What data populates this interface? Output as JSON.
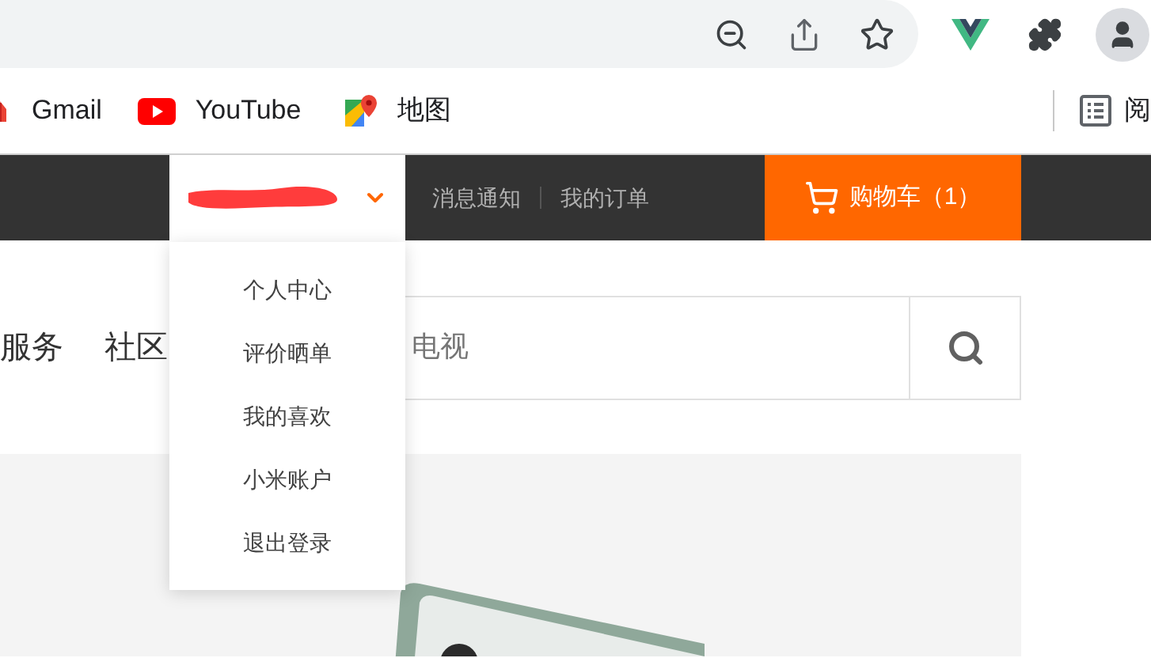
{
  "bookmarks": [
    {
      "kind": "gmail",
      "label": "Gmail"
    },
    {
      "kind": "youtube",
      "label": "YouTube"
    },
    {
      "kind": "maps",
      "label": "地图"
    }
  ],
  "reading_list": {
    "label": "阅"
  },
  "top_bar": {
    "user_menu": {
      "expanded": true,
      "items": [
        "个人中心",
        "评价晒单",
        "我的喜欢",
        "小米账户",
        "退出登录"
      ]
    },
    "links": [
      "消息通知",
      "我的订单"
    ],
    "cart": {
      "label": "购物车（1）"
    }
  },
  "nav": [
    "服务",
    "社区"
  ],
  "search": {
    "placeholder": "电视"
  }
}
